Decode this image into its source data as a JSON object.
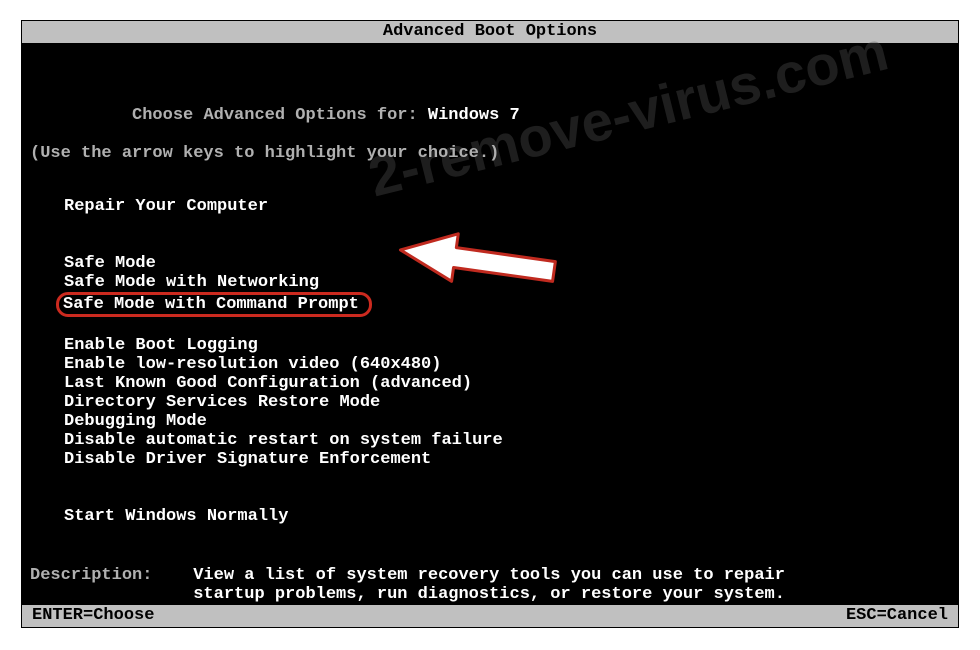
{
  "title": "Advanced Boot Options",
  "intro_line1_a": "Choose Advanced Options for: ",
  "intro_line1_b": "Windows 7",
  "intro_line2": "(Use the arrow keys to highlight your choice.)",
  "groups": [
    {
      "items": [
        {
          "label": "Repair Your Computer",
          "selected": false
        }
      ]
    },
    {
      "items": [
        {
          "label": "Safe Mode",
          "selected": false
        },
        {
          "label": "Safe Mode with Networking",
          "selected": false
        },
        {
          "label": "Safe Mode with Command Prompt",
          "selected": true
        }
      ]
    },
    {
      "items": [
        {
          "label": "Enable Boot Logging",
          "selected": false
        },
        {
          "label": "Enable low-resolution video (640x480)",
          "selected": false
        },
        {
          "label": "Last Known Good Configuration (advanced)",
          "selected": false
        },
        {
          "label": "Directory Services Restore Mode",
          "selected": false
        },
        {
          "label": "Debugging Mode",
          "selected": false
        },
        {
          "label": "Disable automatic restart on system failure",
          "selected": false
        },
        {
          "label": "Disable Driver Signature Enforcement",
          "selected": false
        }
      ]
    },
    {
      "items": [
        {
          "label": "Start Windows Normally",
          "selected": false
        }
      ]
    }
  ],
  "description_label": "Description:    ",
  "description_text": "View a list of system recovery tools you can use to repair startup problems, run diagnostics, or restore your system.",
  "footer_left": "ENTER=Choose",
  "footer_right": "ESC=Cancel",
  "watermark": "2-remove-virus.com",
  "colors": {
    "highlight_border": "#cc2a1f",
    "bg": "#000000",
    "text_dim": "#b0b0b0",
    "text_bright": "#ffffff",
    "bar_bg": "#c0c0c0"
  }
}
